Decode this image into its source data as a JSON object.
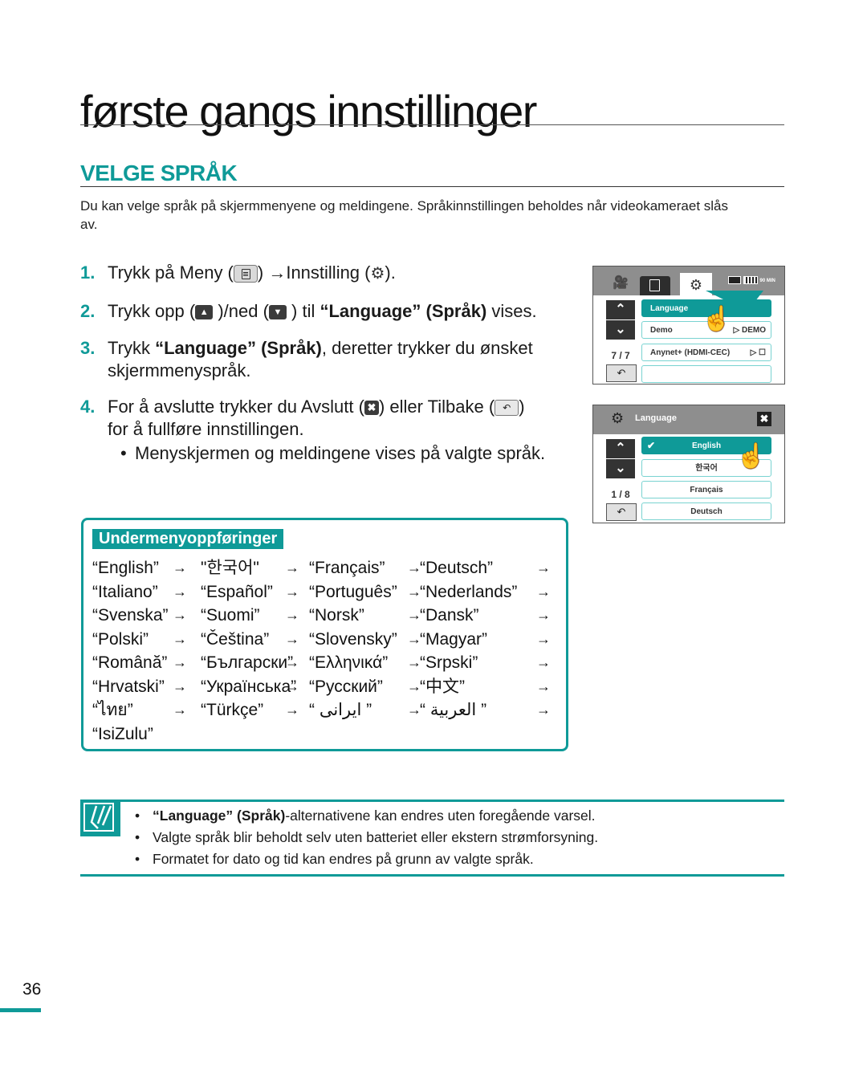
{
  "page": {
    "title": "første gangs innstillinger",
    "section_title": "VELGE SPRÅK",
    "intro": "Du kan velge språk på skjermmenyene og meldingene. Språkinnstillingen beholdes når videokameraet slås av.",
    "page_number": "36",
    "accent_color": "#0f9a98"
  },
  "steps": [
    {
      "num": "1.",
      "parts": [
        "Trykk på Meny (",
        ") →Innstilling (",
        ")."
      ]
    },
    {
      "num": "2.",
      "parts": [
        "Trykk opp (",
        " )/ned (",
        " ) til ",
        "“Language” (Språk)",
        " vises."
      ]
    },
    {
      "num": "3.",
      "parts": [
        "Trykk ",
        "“Language” (Språk)",
        ", deretter trykker du ønsket skjermmenyspråk."
      ]
    },
    {
      "num": "4.",
      "parts": [
        "For å avslutte trykker du Avslutt (",
        ") eller Tilbake (",
        ")",
        "for å fullføre innstillingen."
      ]
    }
  ],
  "sub_bullet": "Menyskjermen og meldingene vises på valgte språk.",
  "icons": {
    "menu": "menu-icon",
    "gear": "⚙",
    "up": "⌃",
    "down": "⌄",
    "close": "✖",
    "back": "↶",
    "arrow": "→"
  },
  "screen1": {
    "tabs": [
      "camera",
      "menu",
      "settings"
    ],
    "status": "90 MIN",
    "page_indicator": "7 / 7",
    "items": [
      {
        "label": "Language",
        "selected": true,
        "right": ""
      },
      {
        "label": "Demo",
        "selected": false,
        "right": "▷ DEMO"
      },
      {
        "label": "Anynet+ (HDMI-CEC)",
        "selected": false,
        "right": "▷ ☐"
      },
      {
        "label": "",
        "selected": false,
        "right": ""
      }
    ]
  },
  "screen2": {
    "title": "Language",
    "page_indicator": "1 / 8",
    "items": [
      {
        "label": "English",
        "selected": true
      },
      {
        "label": "한국어",
        "selected": false
      },
      {
        "label": "Français",
        "selected": false
      },
      {
        "label": "Deutsch",
        "selected": false
      }
    ],
    "check": "✔"
  },
  "submenu": {
    "label": "Undermenyoppføringer",
    "rows": [
      [
        "“English”",
        "\"한국어\"",
        "“Français”",
        "“Deutsch”"
      ],
      [
        "“Italiano”",
        "“Español”",
        "“Português”",
        "“Nederlands”"
      ],
      [
        "“Svenska”",
        "“Suomi”",
        "“Norsk”",
        "“Dansk”"
      ],
      [
        "“Polski”",
        "“Čeština”",
        "“Slovensky”",
        "“Magyar”"
      ],
      [
        "“Română”",
        "“Български”",
        "“Ελληνικά”",
        "“Srpski”"
      ],
      [
        "“Hrvatski”",
        "“Украïнська”",
        "“Русский”",
        "“中文”"
      ],
      [
        "“ไทย”",
        "“Türkçe”",
        "“ ایرانی ”",
        "“ العربية ”"
      ],
      [
        "“IsiZulu”"
      ]
    ]
  },
  "notes": [
    {
      "bold": "“Language” (Språk)",
      "text": "-alternativene kan endres uten foregående varsel."
    },
    {
      "bold": "",
      "text": "Valgte språk blir beholdt selv uten batteriet eller ekstern strømforsyning."
    },
    {
      "bold": "",
      "text": "Formatet for dato og tid kan endres på grunn av valgte språk."
    }
  ]
}
